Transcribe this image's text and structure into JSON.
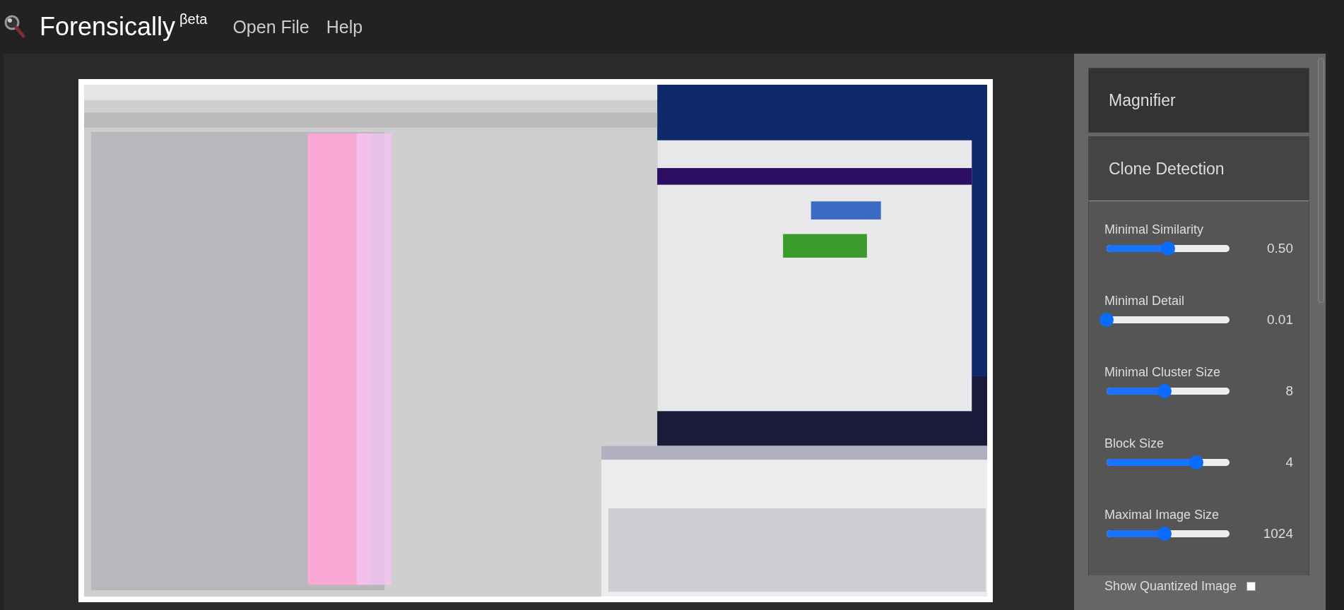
{
  "header": {
    "title": "Forensically",
    "superscript": "βeta",
    "nav": [
      "Open File",
      "Help"
    ]
  },
  "sidebar": {
    "panels": [
      {
        "title": "Magnifier",
        "expanded": false
      },
      {
        "title": "Clone Detection",
        "expanded": true
      }
    ],
    "sliders": [
      {
        "label": "Minimal Similarity",
        "level": 0.5,
        "reading": "0.50"
      },
      {
        "label": "Minimal Detail",
        "level": 0,
        "reading": "0.01"
      },
      {
        "label": "Minimal Cluster Size",
        "level": 0.47,
        "reading": "8"
      },
      {
        "label": "Block Size",
        "level": 0.73,
        "reading": "4"
      },
      {
        "label": "Maximal Image Size",
        "level": 0.47,
        "reading": "1024"
      }
    ],
    "checkbox": {
      "label": "Show Quantized Image",
      "checked": false
    }
  }
}
